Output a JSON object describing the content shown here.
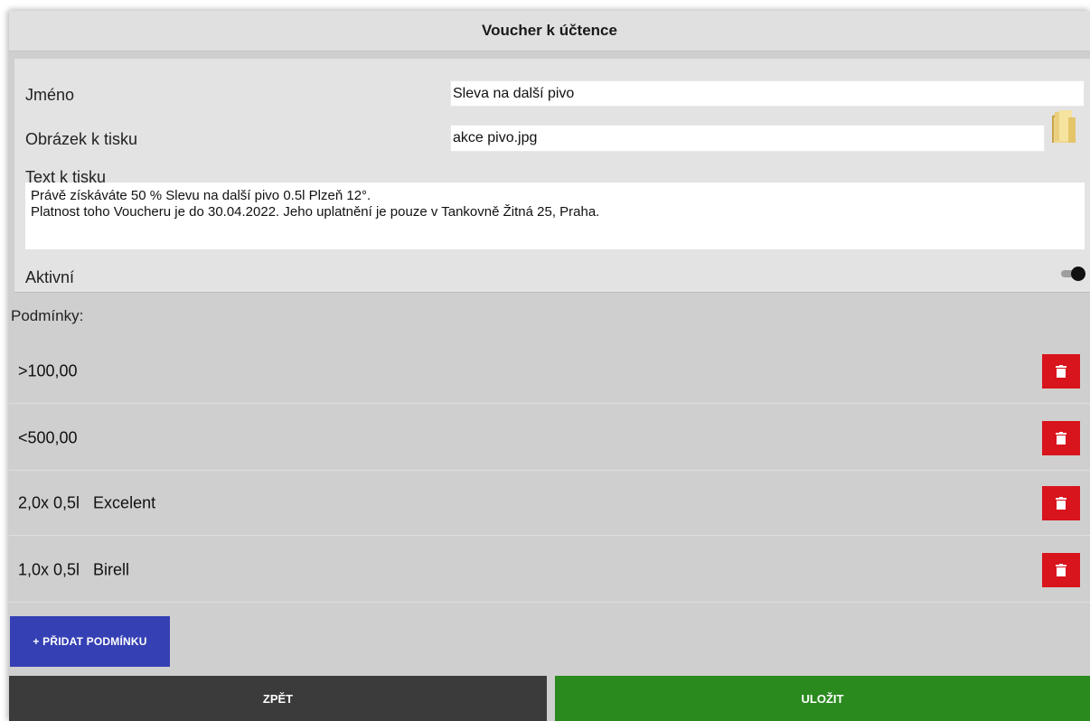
{
  "window": {
    "title": "Voucher k účtence"
  },
  "form": {
    "name_label": "Jméno",
    "name_value": "Sleva na další pivo",
    "image_label": "Obrázek k tisku",
    "image_value": "akce pivo.jpg",
    "text_label": "Text k tisku",
    "text_line1": "Právě získáváte 50 % Slevu na další pivo 0.5l Plzeň 12°.",
    "text_line2": "Platnost toho Voucheru je do 30.04.2022. Jeho uplatnění je pouze v Tankovně Žitná 25, Praha.",
    "active_label": "Aktivní",
    "active_on": true
  },
  "conditions": {
    "header": "Podmínky:",
    "items": [
      {
        "text": ">100,00"
      },
      {
        "text": "<500,00"
      },
      {
        "text": "2,0x 0,5l   Excelent"
      },
      {
        "text": "1,0x 0,5l   Birell"
      }
    ]
  },
  "buttons": {
    "add_condition": "+ PŘIDAT PODMÍNKU",
    "back": "ZPĚT",
    "save": "ULOŽIT"
  },
  "colors": {
    "delete": "#d8141c",
    "add": "#3540b4",
    "back": "#3b3b3b",
    "save": "#2a8a1e"
  },
  "icons": {
    "folder": "folder-icon",
    "delete": "trash-icon"
  }
}
